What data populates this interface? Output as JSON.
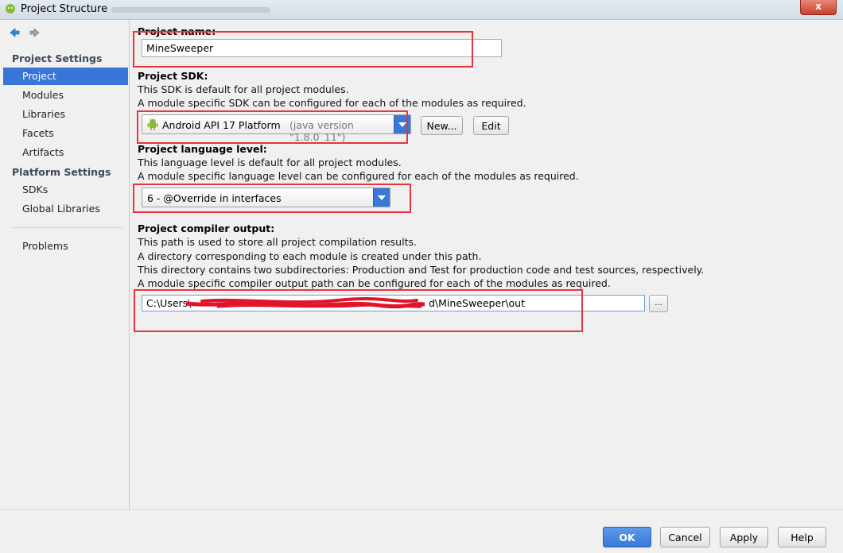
{
  "window": {
    "title": "Project Structure",
    "close_label": "x"
  },
  "sidebar": {
    "project_settings_header": "Project Settings",
    "project_settings_items": [
      {
        "label": "Project"
      },
      {
        "label": "Modules"
      },
      {
        "label": "Libraries"
      },
      {
        "label": "Facets"
      },
      {
        "label": "Artifacts"
      }
    ],
    "platform_settings_header": "Platform Settings",
    "platform_settings_items": [
      {
        "label": "SDKs"
      },
      {
        "label": "Global Libraries"
      }
    ],
    "problems_label": "Problems",
    "selected": "Project"
  },
  "project_name": {
    "label": "Project name:",
    "value": "MineSweeper"
  },
  "project_sdk": {
    "label": "Project SDK:",
    "desc1": "This SDK is default for all project modules.",
    "desc2": "A module specific SDK can be configured for each of the modules as required.",
    "selected": "Android API 17 Platform",
    "selected_detail": "(java version \"1.8.0_11\")",
    "new_button": "New...",
    "edit_button": "Edit"
  },
  "language_level": {
    "label": "Project language level:",
    "desc1": "This language level is default for all project modules.",
    "desc2": "A module specific language level can be configured for each of the modules as required.",
    "selected": "6 - @Override in interfaces"
  },
  "compiler_output": {
    "label": "Project compiler output:",
    "desc1": "This path is used to store all project compilation results.",
    "desc2": "A directory corresponding to each module is created under this path.",
    "desc3": "This directory contains two subdirectories: Production and Test for production code and test sources, respectively.",
    "desc4": "A module specific compiler output path can be configured for each of the modules as required.",
    "path_value": "C:\\Users\\",
    "path_value_end": "d\\MineSweeper\\out",
    "browse_button": "..."
  },
  "footer": {
    "ok": "OK",
    "cancel": "Cancel",
    "apply": "Apply",
    "help": "Help"
  },
  "colors": {
    "selection": "#3875d7",
    "annotation_red": "#e8343a",
    "scribble_red": "#e0142b",
    "android_green": "#8ab83a"
  },
  "icons": {
    "back": "arrow-left-icon",
    "forward": "arrow-right-icon",
    "android": "android-icon",
    "app": "intellij-icon"
  }
}
